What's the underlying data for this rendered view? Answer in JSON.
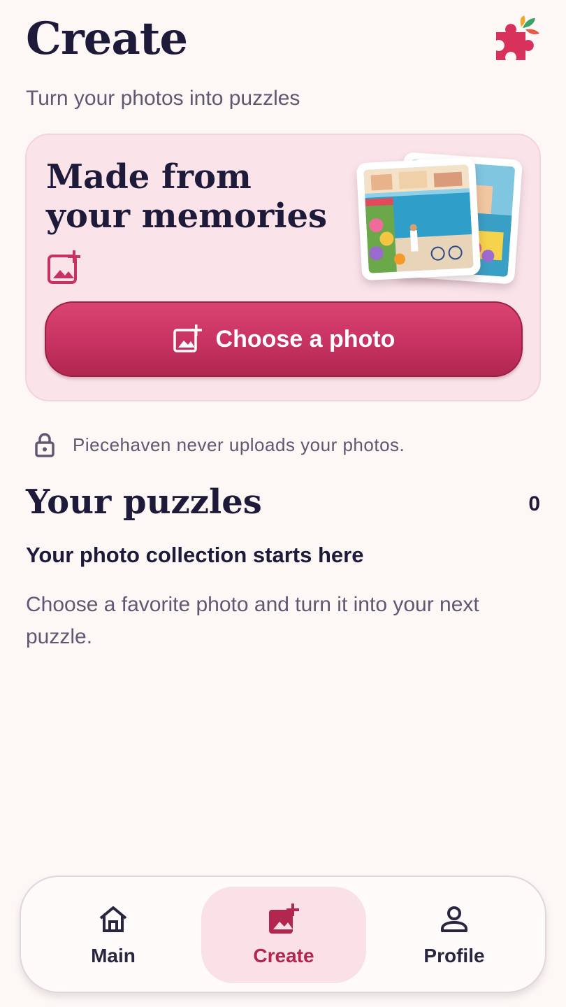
{
  "header": {
    "title": "Create",
    "subtitle": "Turn your photos into puzzles",
    "logo_icon": "puzzle-piece-logo-icon"
  },
  "hero": {
    "title": "Made from your memories",
    "icon": "add-photo-icon",
    "button_label": "Choose a photo",
    "button_icon": "add-photo-icon"
  },
  "privacy": {
    "icon": "lock-icon",
    "text": "Piecehaven never uploads your photos."
  },
  "puzzles": {
    "title": "Your puzzles",
    "count": "0",
    "empty_heading": "Your photo collection starts here",
    "empty_body": "Choose a favorite photo and turn it into your next puzzle."
  },
  "nav": {
    "items": [
      {
        "label": "Main",
        "icon": "home-icon",
        "active": false
      },
      {
        "label": "Create",
        "icon": "add-photo-icon",
        "active": true
      },
      {
        "label": "Profile",
        "icon": "person-icon",
        "active": false
      }
    ]
  },
  "colors": {
    "background": "#fdf8f6",
    "accent": "#c73262",
    "card": "#fae4ea",
    "text_primary": "#1e1a3a",
    "text_secondary": "#5e5870"
  }
}
